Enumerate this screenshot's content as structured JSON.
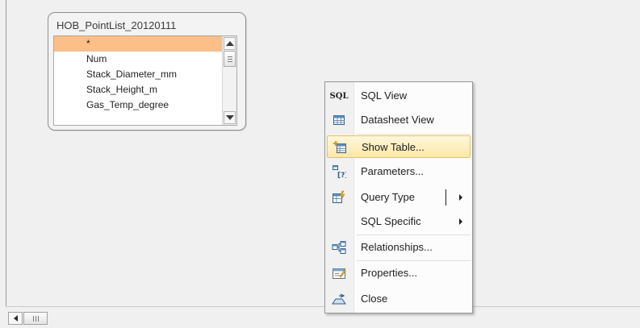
{
  "table_window": {
    "title": "HOB_PointList_20120111",
    "fields": [
      {
        "label": "*",
        "selected": true
      },
      {
        "label": "Num"
      },
      {
        "label": "Stack_Diameter_mm"
      },
      {
        "label": "Stack_Height_m"
      },
      {
        "label": "Gas_Temp_degree"
      }
    ]
  },
  "context_menu": {
    "items": [
      {
        "id": "sql-view",
        "label": "SQL View",
        "icon": "sql-icon",
        "icon_text": "SQL"
      },
      {
        "id": "datasheet-view",
        "label": "Datasheet View",
        "icon": "datasheet-icon"
      },
      {
        "id": "show-table",
        "label": "Show Table...",
        "icon": "show-table-icon",
        "highlighted": true
      },
      {
        "id": "parameters",
        "label": "Parameters...",
        "icon": "parameters-icon"
      },
      {
        "id": "query-type",
        "label": "Query Type",
        "icon": "query-type-icon",
        "submenu": true
      },
      {
        "id": "sql-specific",
        "label": "SQL Specific",
        "submenu": true
      },
      {
        "id": "relationships",
        "label": "Relationships...",
        "icon": "relationships-icon"
      },
      {
        "id": "properties",
        "label": "Properties...",
        "icon": "properties-icon"
      },
      {
        "id": "close",
        "label": "Close",
        "icon": "close-icon"
      }
    ]
  },
  "colors": {
    "selected_field": "#fbbf87",
    "menu_highlight": "#fce8a8",
    "menu_highlight_border": "#e5c365"
  }
}
